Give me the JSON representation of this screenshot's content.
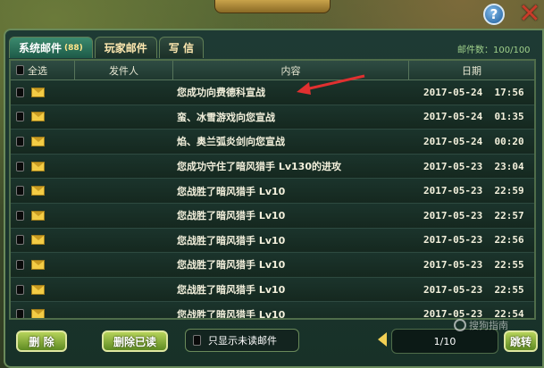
{
  "header": {
    "help_label": "?",
    "close_label": "✕"
  },
  "tabs": [
    {
      "label": "系统邮件",
      "count": "(88)",
      "active": true
    },
    {
      "label": "玩家邮件"
    },
    {
      "label": "写 信"
    }
  ],
  "mail_count": "邮件数：100/100",
  "table": {
    "columns": {
      "select": "全选",
      "sender": "发件人",
      "content": "内容",
      "date": "日期"
    },
    "rows": [
      {
        "content": "您成功向费德科宣战",
        "date": "2017-05-24  17:56"
      },
      {
        "content": "蛮、冰雪游戏向您宣战",
        "date": "2017-05-24  01:35"
      },
      {
        "content": "焰、奥兰弧炎剑向您宣战",
        "date": "2017-05-24  00:20"
      },
      {
        "content": "您成功守住了暗风猎手 Lv130的进攻",
        "date": "2017-05-23  23:04"
      },
      {
        "content": "您战胜了暗风猎手 Lv10",
        "date": "2017-05-23  22:59"
      },
      {
        "content": "您战胜了暗风猎手 Lv10",
        "date": "2017-05-23  22:57"
      },
      {
        "content": "您战胜了暗风猎手 Lv10",
        "date": "2017-05-23  22:56"
      },
      {
        "content": "您战胜了暗风猎手 Lv10",
        "date": "2017-05-23  22:55"
      },
      {
        "content": "您战胜了暗风猎手 Lv10",
        "date": "2017-05-23  22:55"
      },
      {
        "content": "您战胜了暗风猎手 Lv10",
        "date": "2017-05-23  22:54"
      }
    ]
  },
  "footer": {
    "delete_label": "删 除",
    "delete_read_label": "删除已读",
    "unread_only_label": "只显示未读邮件",
    "page_indicator": "1/10",
    "jump_label": "跳转"
  },
  "watermark": {
    "text": "搜狗指南"
  },
  "colors": {
    "accent": "#5e8a22",
    "arrow": "#e03030",
    "envelope": "#f3cc45"
  }
}
